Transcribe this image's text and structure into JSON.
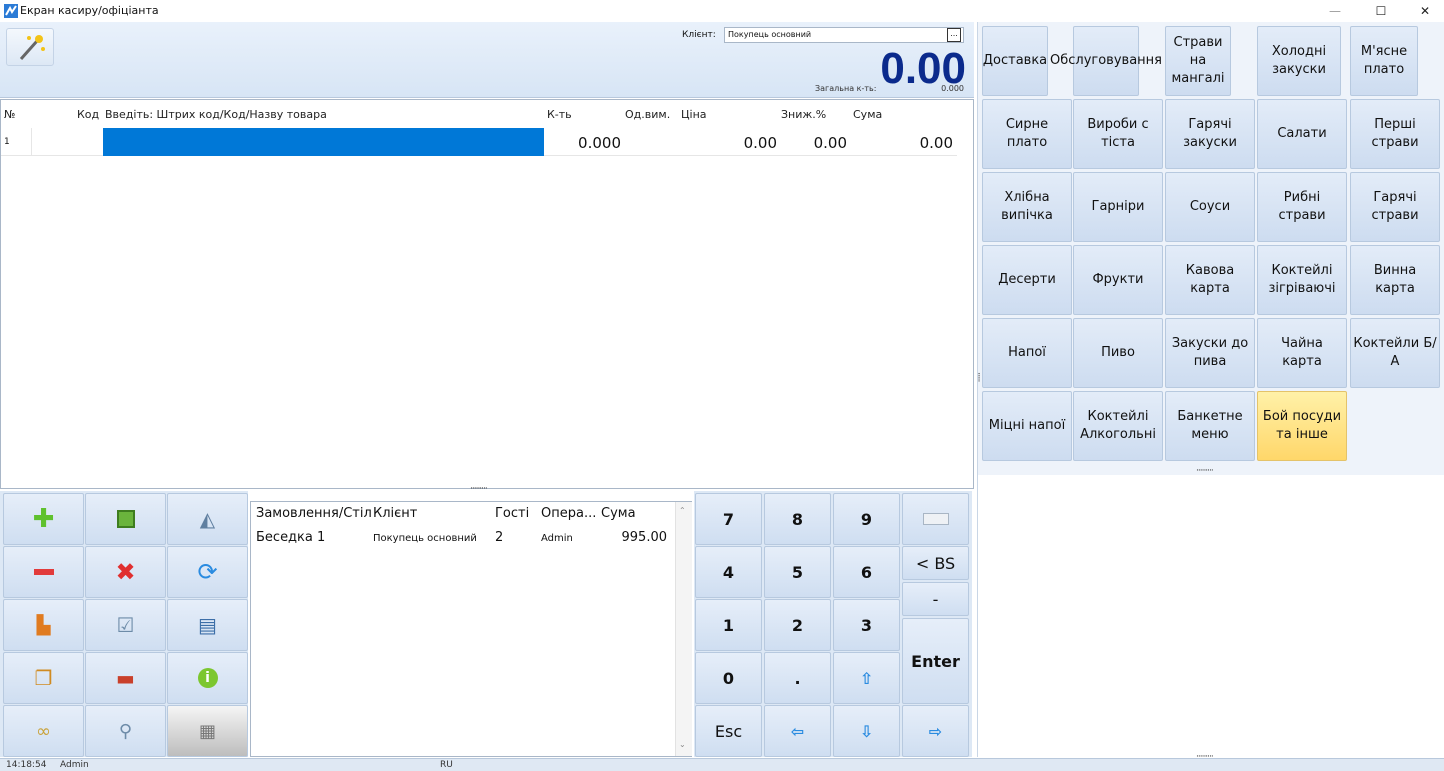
{
  "window": {
    "title": "Екран касиру/офіціанта",
    "minimize": "—",
    "maximize": "☐",
    "close": "✕"
  },
  "header": {
    "client_label": "Клієнт:",
    "client_value": "Покупець основний",
    "client_picker": "...",
    "total": "0.00",
    "total_qty_label": "Загальна к-ть:",
    "total_qty_value": "0.000"
  },
  "grid": {
    "columns": [
      "№",
      "Код",
      "Введіть: Штрих код/Код/Назву товара",
      "К-ть",
      "Од.вим.",
      "Ціна",
      "Зниж.%",
      "Сума"
    ],
    "row": {
      "no": "1",
      "qty": "0.000",
      "price": "0.00",
      "discount": "0.00",
      "sum": "0.00"
    }
  },
  "orders": {
    "columns": [
      "Замовлення/Стіл",
      "Клієнт",
      "Гості",
      "Опера...",
      "Сума"
    ],
    "rows": [
      {
        "table": "Беседка 1",
        "client": "Покупець основний",
        "guests": "2",
        "operator": "Admin",
        "sum": "995.00"
      }
    ]
  },
  "keypad": {
    "k7": "7",
    "k8": "8",
    "k9": "9",
    "bs": "< BS",
    "k4": "4",
    "k5": "5",
    "k6": "6",
    "minus": "-",
    "k1": "1",
    "k2": "2",
    "k3": "3",
    "enter": "Enter",
    "k0": "0",
    "dot": ".",
    "esc": "Esc"
  },
  "categories": [
    "Доставка",
    "Обслуговування",
    "Страви на мангалі",
    "Холодні закуски",
    "М'ясне плато",
    "Сирне плато",
    "Вироби с тіста",
    "Гарячі закуски",
    "Салати",
    "Перші страви",
    "Хлібна випічка",
    "Гарніри",
    "Соуси",
    "Рибні страви",
    "Гарячі страви",
    "Десерти",
    "Фрукти",
    "Кавова карта",
    "Коктейлі зігріваючі",
    "Винна карта",
    "Напої",
    "Пиво",
    "Закуски до пива",
    "Чайна карта",
    "Коктейли Б/А",
    "Міцні напої",
    "Коктейлі Алкогольні",
    "Банкетне меню",
    "Бой посуди та інше"
  ],
  "status": {
    "time": "14:18:54",
    "user": "Admin",
    "lang": "RU"
  },
  "colors": {
    "accent": "#0078d7",
    "total": "#0b2a8c",
    "highlight": "#ffd76a"
  }
}
